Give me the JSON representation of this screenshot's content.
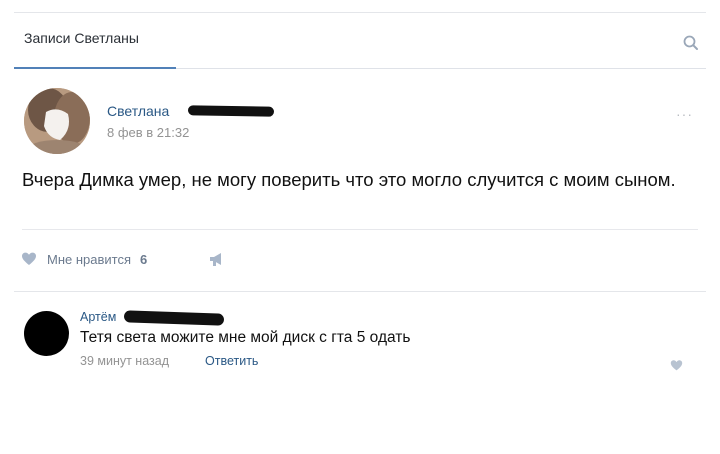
{
  "tabs": {
    "active_label": "Записи Светланы"
  },
  "post": {
    "author": "Светлана",
    "date": "8 фев в 21:32",
    "menu": "···",
    "text": "Вчера Димка умер, не могу поверить что это могло случится с моим сыном.",
    "like_label": "Мне нравится",
    "like_count": "6"
  },
  "comment": {
    "author": "Артём",
    "text": "Тетя света можите мне мой диск с гта 5 одать",
    "time": "39 минут назад",
    "reply_label": "Ответить"
  },
  "icons": {
    "search": "search-icon",
    "heart": "heart-icon",
    "share": "share-megaphone-icon",
    "more": "more-dots-icon"
  },
  "colors": {
    "link": "#2a5885",
    "tab_underline": "#5181b8",
    "muted": "#939393",
    "icon": "#a8b6c9"
  }
}
